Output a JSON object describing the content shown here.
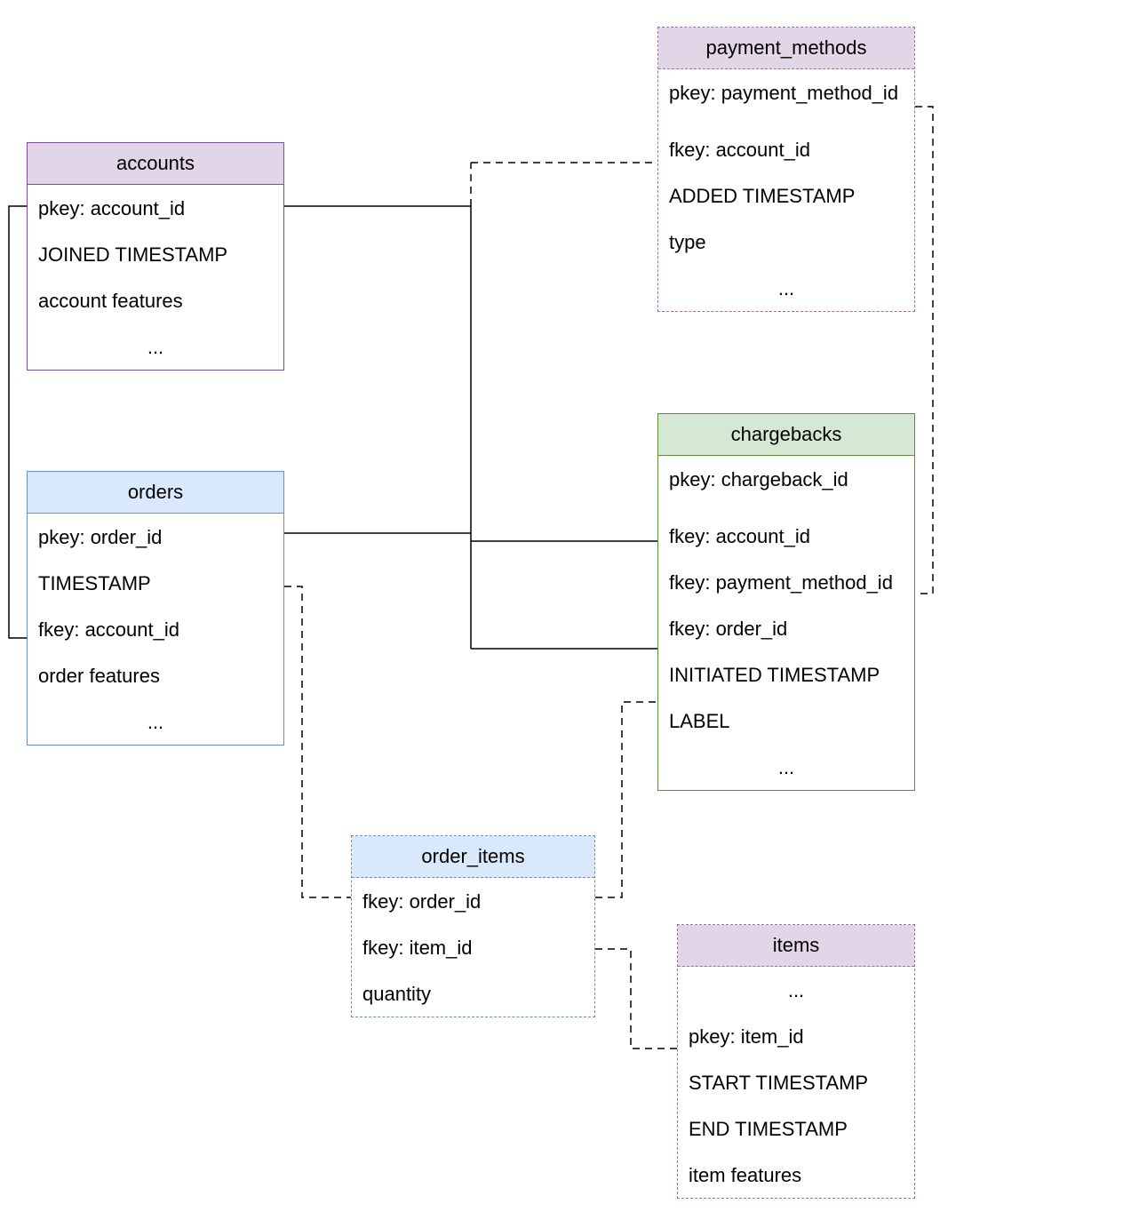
{
  "entities": {
    "accounts": {
      "title": "accounts",
      "rows": [
        "pkey: account_id",
        "JOINED TIMESTAMP",
        "account features"
      ],
      "ellipsis": "..."
    },
    "orders": {
      "title": "orders",
      "rows": [
        "pkey: order_id",
        "TIMESTAMP",
        "fkey: account_id",
        "order features"
      ],
      "ellipsis": "..."
    },
    "order_items": {
      "title": "order_items",
      "rows": [
        "fkey: order_id",
        "fkey: item_id",
        "quantity"
      ]
    },
    "payment_methods": {
      "title": "payment_methods",
      "rows": [
        "pkey: payment_method_id",
        "fkey: account_id",
        "ADDED TIMESTAMP",
        "type"
      ],
      "ellipsis": "..."
    },
    "chargebacks": {
      "title": "chargebacks",
      "rows": [
        "pkey: chargeback_id",
        "fkey: account_id",
        "fkey: payment_method_id",
        "fkey: order_id",
        "INITIATED TIMESTAMP",
        "LABEL"
      ],
      "ellipsis": "..."
    },
    "items": {
      "title": "items",
      "ellipsis_top": "...",
      "rows": [
        "pkey: item_id",
        "START TIMESTAMP",
        "END TIMESTAMP",
        "item features"
      ]
    }
  }
}
